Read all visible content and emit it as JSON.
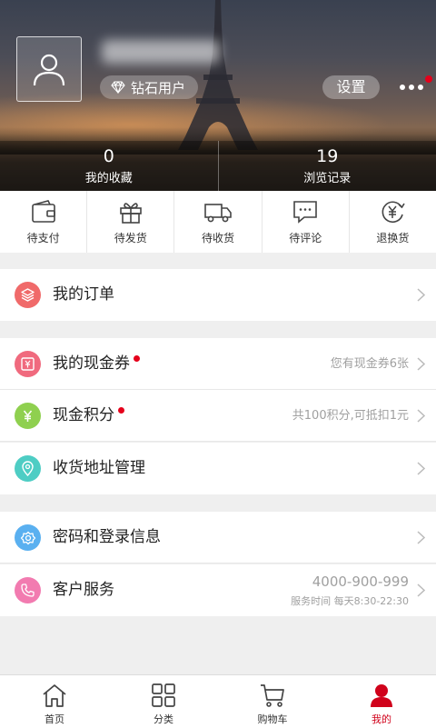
{
  "profile": {
    "badge_label": "钻石用户",
    "settings_label": "设置"
  },
  "stats": [
    {
      "value": "0",
      "label": "我的收藏"
    },
    {
      "value": "19",
      "label": "浏览记录"
    }
  ],
  "order_status": [
    {
      "label": "待支付",
      "icon": "wallet-icon"
    },
    {
      "label": "待发货",
      "icon": "gift-icon"
    },
    {
      "label": "待收货",
      "icon": "truck-icon"
    },
    {
      "label": "待评论",
      "icon": "comment-icon"
    },
    {
      "label": "退换货",
      "icon": "yen-refund-icon"
    }
  ],
  "menu": {
    "orders": {
      "label": "我的订单",
      "icon": "layers-icon",
      "color": "#f06a6a"
    },
    "cash_coupon": {
      "label": "我的现金券",
      "hint": "您有现金券6张",
      "icon": "coupon-icon",
      "color": "#f06a7e"
    },
    "points": {
      "label": "现金积分",
      "hint": "共100积分,可抵扣1元",
      "icon": "yen-icon",
      "color": "#8fd04f"
    },
    "address": {
      "label": "收货地址管理",
      "icon": "location-icon",
      "color": "#4ecdc4"
    },
    "password": {
      "label": "密码和登录信息",
      "icon": "gear-icon",
      "color": "#5ab0f0"
    },
    "service": {
      "label": "客户服务",
      "phone": "4000-900-999",
      "hours": "服务时间 每天8:30-22:30",
      "icon": "phone-icon",
      "color": "#f27bb0"
    }
  },
  "tabbar": [
    {
      "label": "首页",
      "icon": "home-icon"
    },
    {
      "label": "分类",
      "icon": "grid-icon"
    },
    {
      "label": "购物车",
      "icon": "cart-icon"
    },
    {
      "label": "我的",
      "icon": "user-icon",
      "active": true
    }
  ],
  "colors": {
    "accent": "#d0021b",
    "badge_dot": "#e5001b"
  }
}
